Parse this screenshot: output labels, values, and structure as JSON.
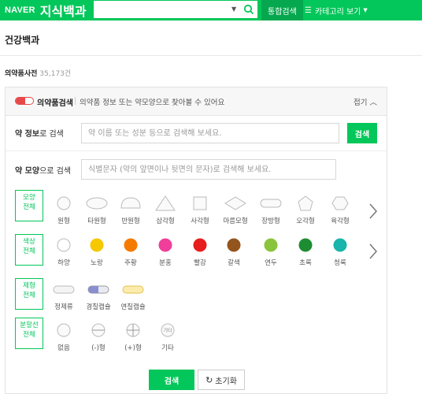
{
  "header": {
    "logo_naver": "NAVER",
    "logo_service": "지식백과",
    "search_value": "",
    "integrated_label": "통합검색",
    "category_label": "카테고리 보기"
  },
  "section_title": "건강백과",
  "dictionary": {
    "name": "의약품사전",
    "count": "35,173건"
  },
  "panel": {
    "title": "의약품검색",
    "description": "의약품 정보 또는 약모양으로 찾아볼 수 있어요",
    "fold_label": "접기"
  },
  "info_search": {
    "label_bold": "약 정보",
    "label_rest": "로 검색",
    "placeholder": "약 이름 또는 성분 등으로 검색해 보세요.",
    "button": "검색"
  },
  "shape_search": {
    "label_bold": "약 모양",
    "label_rest": "으로 검색",
    "placeholder": "식별문자 (약의 앞면이나 뒷면의 문자)로 검색해 보세요."
  },
  "filters": {
    "shape": {
      "tag_line1": "모양",
      "tag_line2": "전체",
      "options": [
        "원형",
        "타원형",
        "반원형",
        "삼각형",
        "사각형",
        "마름모형",
        "장방형",
        "오각형",
        "육각형"
      ]
    },
    "color": {
      "tag_line1": "색상",
      "tag_line2": "전체",
      "options": [
        {
          "label": "하양",
          "color": "#ffffff"
        },
        {
          "label": "노랑",
          "color": "#f5c800"
        },
        {
          "label": "주황",
          "color": "#f57a00"
        },
        {
          "label": "분홍",
          "color": "#f03e9b"
        },
        {
          "label": "빨강",
          "color": "#e61e1e"
        },
        {
          "label": "갈색",
          "color": "#94541e"
        },
        {
          "label": "연두",
          "color": "#8ac43c"
        },
        {
          "label": "초록",
          "color": "#1e8c32"
        },
        {
          "label": "청록",
          "color": "#19b4aa"
        }
      ]
    },
    "form": {
      "tag_line1": "제형",
      "tag_line2": "전체",
      "options": [
        "정제류",
        "경질캡슐",
        "연질캡슐"
      ]
    },
    "split": {
      "tag_line1": "분할선",
      "tag_line2": "전체",
      "options": [
        "없음",
        "(-)형",
        "(+)형",
        "기타"
      ],
      "other_icon_text": "기타"
    }
  },
  "bottom": {
    "search_button": "검색",
    "reset_button": "초기화"
  },
  "colors": {
    "brand_green": "#03c75a"
  }
}
